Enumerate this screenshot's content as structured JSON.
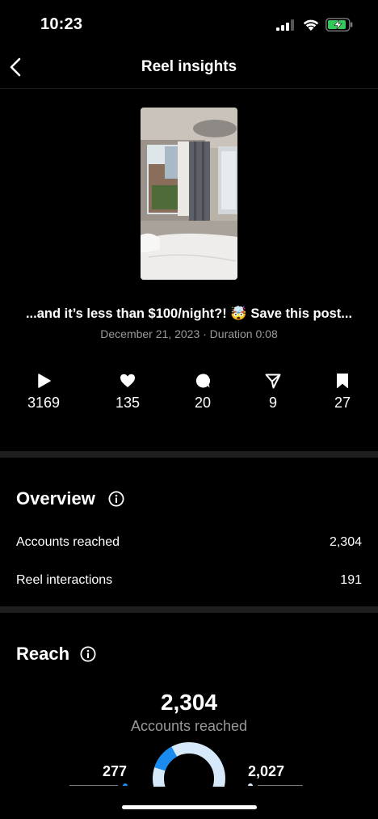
{
  "status_bar": {
    "time": "10:23"
  },
  "nav": {
    "title": "Reel insights"
  },
  "post": {
    "caption": "...and it’s less than $100/night?! 🤯 Save this post...",
    "meta": "December 21, 2023 · Duration 0:08"
  },
  "stats": [
    {
      "icon": "play-icon",
      "value": "3169"
    },
    {
      "icon": "heart-icon",
      "value": "135"
    },
    {
      "icon": "comment-icon",
      "value": "20"
    },
    {
      "icon": "share-icon",
      "value": "9"
    },
    {
      "icon": "bookmark-icon",
      "value": "27"
    }
  ],
  "overview": {
    "title": "Overview",
    "rows": [
      {
        "label": "Accounts reached",
        "value": "2,304"
      },
      {
        "label": "Reel interactions",
        "value": "191"
      }
    ]
  },
  "reach": {
    "title": "Reach",
    "total": "2,304",
    "total_label": "Accounts reached",
    "followers": "277",
    "non_followers": "2,027",
    "followers_fraction": 0.12
  },
  "colors": {
    "accent": "#1a8cf0",
    "donut_rest": "#d6e9fb",
    "divider": "#1e1e1e"
  }
}
